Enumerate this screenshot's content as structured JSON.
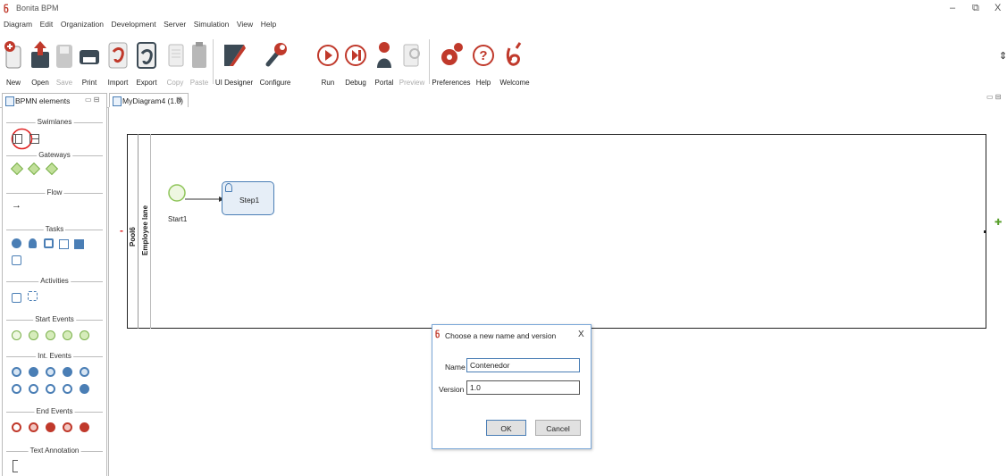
{
  "window": {
    "title": "Bonita BPM",
    "logo_glyph": "ნ",
    "minimize_glyph": "–",
    "restore_glyph": "⧉",
    "close_glyph": "X",
    "toolbar_overflow_glyph": "⇕"
  },
  "menu": [
    "Diagram",
    "Edit",
    "Organization",
    "Development",
    "Server",
    "Simulation",
    "View",
    "Help"
  ],
  "toolbar": [
    {
      "label": "New",
      "icon": "new-file-icon",
      "disabled": false
    },
    {
      "label": "Open",
      "icon": "open-icon",
      "disabled": false
    },
    {
      "label": "Save",
      "icon": "save-icon",
      "disabled": true
    },
    {
      "label": "Print",
      "icon": "print-icon",
      "disabled": false
    },
    {
      "label": "Import",
      "icon": "import-icon",
      "disabled": false
    },
    {
      "label": "Export",
      "icon": "export-icon",
      "disabled": false
    },
    {
      "label": "Copy",
      "icon": "copy-icon",
      "disabled": true
    },
    {
      "label": "Paste",
      "icon": "paste-icon",
      "disabled": true
    },
    {
      "label": "UI Designer",
      "icon": "ui-designer-icon",
      "disabled": false
    },
    {
      "label": "Configure",
      "icon": "configure-icon",
      "disabled": false
    },
    {
      "label": "Run",
      "icon": "run-icon",
      "disabled": false
    },
    {
      "label": "Debug",
      "icon": "debug-icon",
      "disabled": false
    },
    {
      "label": "Portal",
      "icon": "portal-icon",
      "disabled": false
    },
    {
      "label": "Preview",
      "icon": "preview-icon",
      "disabled": true
    },
    {
      "label": "Preferences",
      "icon": "preferences-icon",
      "disabled": false
    },
    {
      "label": "Help",
      "icon": "help-icon",
      "disabled": false
    },
    {
      "label": "Welcome",
      "icon": "welcome-icon",
      "disabled": false
    }
  ],
  "palette": {
    "tab_label": "BPMN elements",
    "tab_controls": "▭ ⊟",
    "sections": {
      "swimlanes": "Swimlanes",
      "gateways": "Gateways",
      "flow": "Flow",
      "tasks": "Tasks",
      "activities": "Activities",
      "start_events": "Start Events",
      "int_events": "Int. Events",
      "end_events": "End Events",
      "text_annotation": "Text Annotation"
    },
    "flow_arrow": "→"
  },
  "editor": {
    "tab_label": "MyDiagram4 (1.0)",
    "tab_close": "⊠",
    "panel_controls": "▭ ⊟",
    "pool_label": "Pool6",
    "lane_label": "Employee lane",
    "collapse_marker": "-",
    "add_marker": "✚",
    "start_event_label": "Start1",
    "task_label": "Step1"
  },
  "dialog": {
    "title": "Choose a new name and version",
    "close": "X",
    "name_label": "Name",
    "name_value": "Contenedor",
    "version_label": "Version",
    "version_value": "1.0",
    "ok_label": "OK",
    "cancel_label": "Cancel"
  },
  "colors": {
    "accent_red": "#c0392b",
    "start_event_green": "#8fc55a",
    "task_blue": "#4a7eb5",
    "dialog_border": "#7aa7d8"
  }
}
